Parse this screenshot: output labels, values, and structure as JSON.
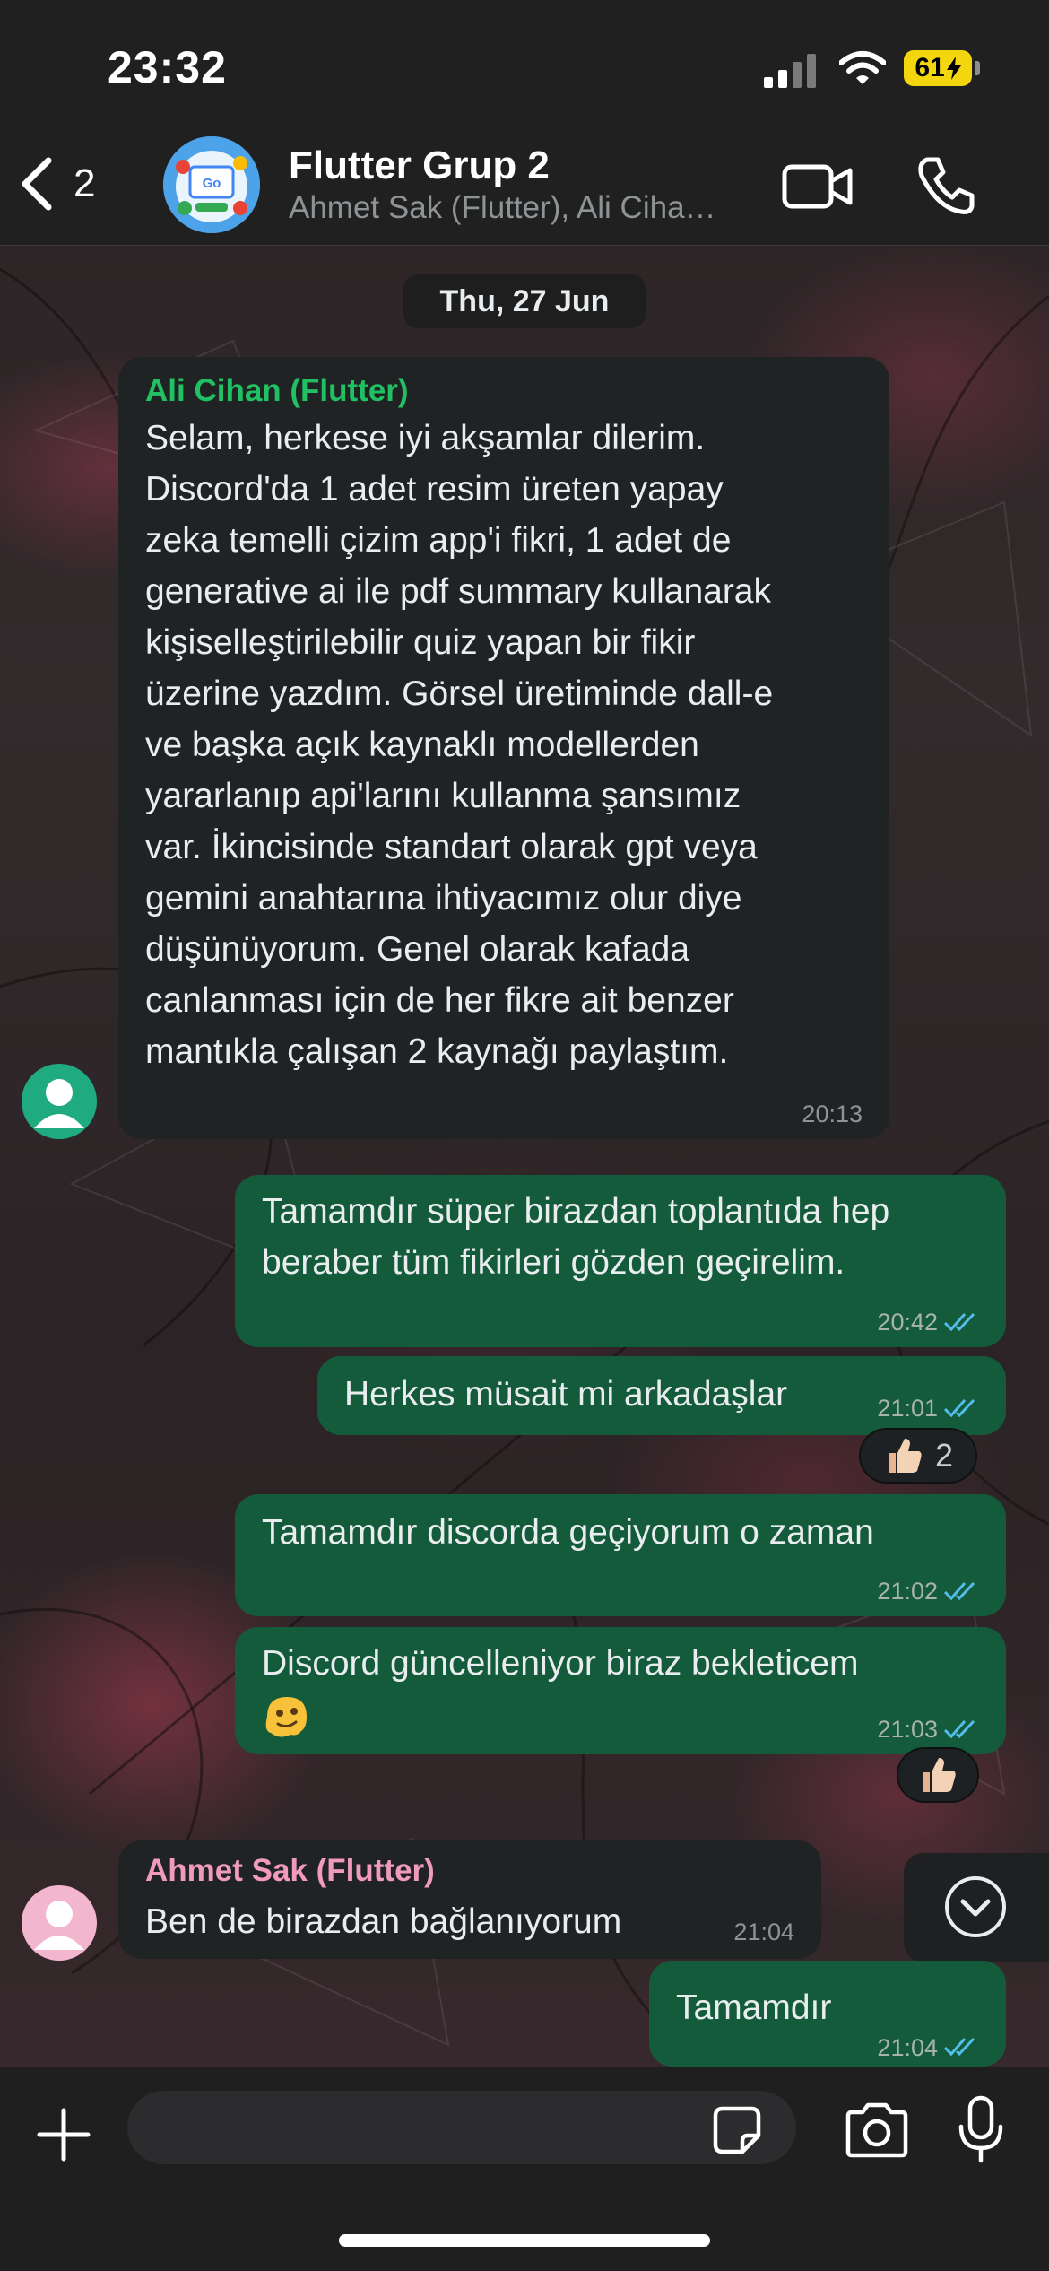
{
  "status_bar": {
    "time": "23:32",
    "battery": "61"
  },
  "header": {
    "back_count": "2",
    "title": "Flutter Grup 2",
    "subtitle": "Ahmet Sak (Flutter), Ali Ciha…"
  },
  "date_chip": "Thu, 27 Jun",
  "messages": [
    {
      "direction": "in",
      "sender": "Ali Cihan (Flutter)",
      "sender_color": "#21c063",
      "text": "Selam, herkese iyi akşamlar dilerim.\nDiscord'da 1 adet resim üreten yapay\nzeka temelli çizim app'i fikri, 1 adet de\ngenerative ai ile pdf summary kullanarak\nkişiselleştirilebilir quiz yapan bir fikir\nüzerine yazdım. Görsel üretiminde dall-e\nve başka açık kaynaklı modellerden\nyararlanıp api'larını kullanma şansımız\nvar. İkincisinde standart olarak gpt veya\ngemini anahtarına ihtiyacımız olur diye\ndüşünüyorum. Genel olarak kafada\ncanlanması için de her fikre ait benzer\nmantıkla çalışan 2 kaynağı paylaştım.",
      "time": "20:13"
    },
    {
      "direction": "out",
      "text": "Tamamdır süper birazdan toplantıda hep\nberaber tüm fikirleri gözden geçirelim.",
      "time": "20:42"
    },
    {
      "direction": "out",
      "text": "Herkes müsait mi arkadaşlar",
      "time": "21:01",
      "reaction": {
        "emoji": "thumbs-up",
        "count": "2"
      }
    },
    {
      "direction": "out",
      "text": "Tamamdır discorda geçiyorum o zaman",
      "time": "21:02"
    },
    {
      "direction": "out",
      "text": "Discord güncelleniyor biraz bekleticem",
      "emoji": "melting-face",
      "time": "21:03",
      "reaction": {
        "emoji": "thumbs-up"
      }
    },
    {
      "direction": "in",
      "sender": "Ahmet Sak (Flutter)",
      "sender_color": "#f09bbd",
      "text": "Ben de birazdan bağlanıyorum",
      "time": "21:04"
    },
    {
      "direction": "out",
      "text": "Tamamdır",
      "time": "21:04"
    }
  ],
  "composer": {
    "placeholder": ""
  },
  "colors": {
    "incoming_bubble": "#202324",
    "outgoing_bubble": "#145b3b",
    "read_ticks": "#53bdeb",
    "avatar_green": "#1faa7f",
    "avatar_pink": "#f3b6cf"
  },
  "icons": [
    "back-chevron-icon",
    "video-call-icon",
    "phone-icon",
    "chevron-down-circle-icon",
    "plus-icon",
    "sticker-icon",
    "camera-icon",
    "microphone-icon",
    "read-ticks-icon",
    "person-icon"
  ]
}
